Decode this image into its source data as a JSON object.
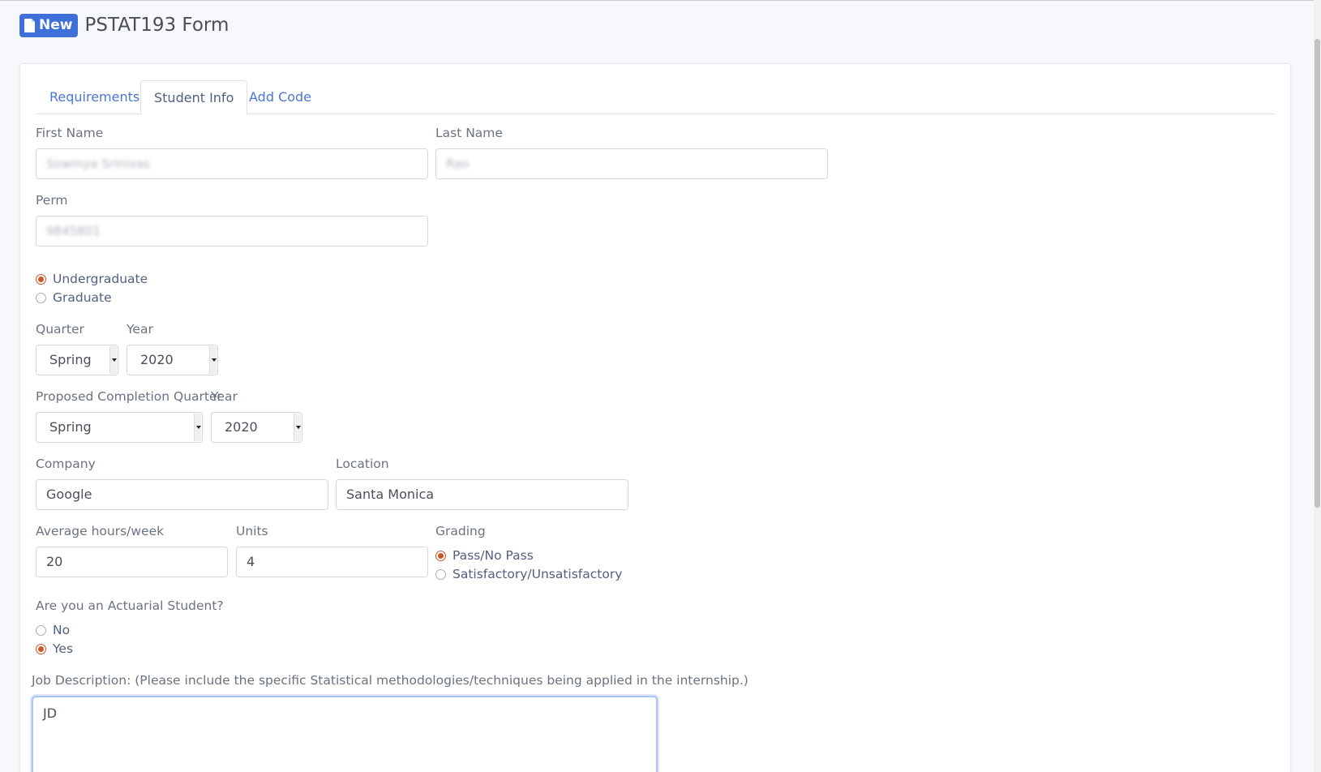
{
  "header": {
    "badge_label": "New",
    "title": "PSTAT193 Form"
  },
  "tabs": [
    {
      "label": "Requirements",
      "active": false
    },
    {
      "label": "Student Info",
      "active": true
    },
    {
      "label": "Add Code",
      "active": false
    }
  ],
  "form": {
    "first_name": {
      "label": "First Name",
      "value": "Sowmya Srinivas"
    },
    "last_name": {
      "label": "Last Name",
      "value": "Rao"
    },
    "perm": {
      "label": "Perm",
      "value": "9845801"
    },
    "level": {
      "options": [
        "Undergraduate",
        "Graduate"
      ],
      "selected": "Undergraduate"
    },
    "quarter": {
      "label": "Quarter",
      "value": "Spring"
    },
    "year": {
      "label": "Year",
      "value": "2020"
    },
    "completion_quarter": {
      "label": "Proposed Completion Quarter",
      "value": "Spring"
    },
    "completion_year": {
      "label": "Year",
      "value": "2020"
    },
    "company": {
      "label": "Company",
      "value": "Google"
    },
    "location": {
      "label": "Location",
      "value": "Santa Monica"
    },
    "hours": {
      "label": "Average hours/week",
      "value": "20"
    },
    "units": {
      "label": "Units",
      "value": "4"
    },
    "grading": {
      "label": "Grading",
      "options": [
        "Pass/No Pass",
        "Satisfactory/Unsatisfactory"
      ],
      "selected": "Pass/No Pass"
    },
    "actuarial": {
      "label": "Are you an Actuarial Student?",
      "options": [
        "No",
        "Yes"
      ],
      "selected": "Yes"
    },
    "job_description": {
      "label": "Job Description: (Please include the specific Statistical methodologies/techniques being applied in the internship.)",
      "value": "JD"
    }
  },
  "colors": {
    "accent": "#3f6fd8",
    "link": "#4a77d6",
    "radio_checked": "#c9582a",
    "focus": "#a9c5f5"
  },
  "icons": {
    "badge_icon": "file-icon"
  }
}
